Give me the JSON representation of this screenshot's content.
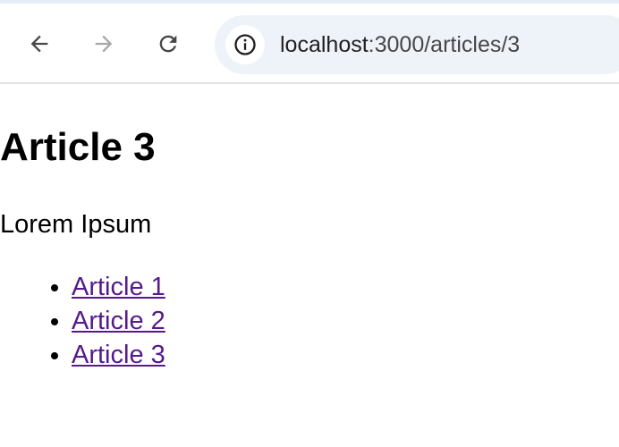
{
  "browser": {
    "url_host": "localhost",
    "url_path": ":3000/articles/3",
    "icons": {
      "back": "arrow-left-icon",
      "forward": "arrow-right-icon",
      "reload": "reload-icon",
      "site_info": "info-circle-icon"
    }
  },
  "page": {
    "title": "Article 3",
    "body": "Lorem Ipsum",
    "links": [
      {
        "label": "Article 1"
      },
      {
        "label": "Article 2"
      },
      {
        "label": "Article 3"
      }
    ]
  },
  "colors": {
    "visited_link": "#551a8b",
    "omnibox_bg": "#eef2f9"
  }
}
